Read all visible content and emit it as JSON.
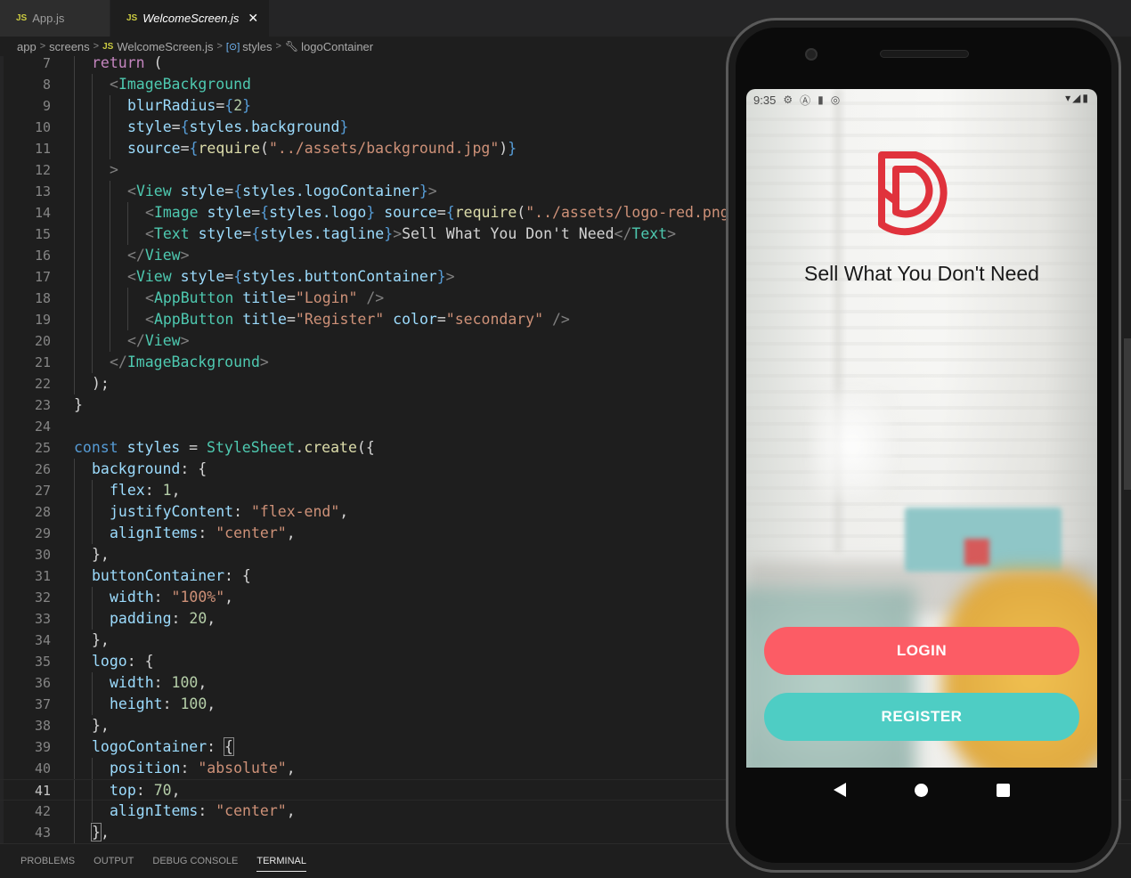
{
  "tabs": [
    {
      "label": "App.js",
      "icon": "JS"
    },
    {
      "label": "WelcomeScreen.js",
      "icon": "JS",
      "close": "✕"
    }
  ],
  "breadcrumb": [
    "app",
    "screens",
    "WelcomeScreen.js",
    "styles",
    "logoContainer"
  ],
  "breadcrumb_js": "JS",
  "code": {
    "lines": [
      "7",
      "8",
      "9",
      "10",
      "11",
      "12",
      "13",
      "14",
      "15",
      "16",
      "17",
      "18",
      "19",
      "20",
      "21",
      "22",
      "23",
      "24",
      "25",
      "26",
      "27",
      "28",
      "29",
      "30",
      "31",
      "32",
      "33",
      "34",
      "35",
      "36",
      "37",
      "38",
      "39",
      "40",
      "41",
      "42",
      "43"
    ],
    "l7": "return",
    "l7b": " (",
    "image_background": "ImageBackground",
    "blur_radius": "blurRadius",
    "blur_value": "2",
    "style_attr": "style",
    "styles_background": "styles.background",
    "source_attr": "source",
    "require": "require",
    "bg_path": "\"../assets/background.jpg\"",
    "view": "View",
    "styles_logo_container": "styles.logoContainer",
    "image": "Image",
    "styles_logo": "styles.logo",
    "logo_path": "\"../assets/logo-red.png",
    "text": "Text",
    "styles_tagline": "styles.tagline",
    "tagline_text": "Sell What You Don't Need",
    "styles_button_container": "styles.buttonContainer",
    "app_button": "AppButton",
    "title_attr": "title",
    "login_title": "\"Login\"",
    "register_title": "\"Register\"",
    "color_attr": "color",
    "secondary": "\"secondary\"",
    "const": "const",
    "styles_name": "styles",
    "stylesheet": "StyleSheet",
    "create": "create",
    "background": "background",
    "flex": "flex",
    "flex_val": "1",
    "justify_content": "justifyContent",
    "flex_end": "\"flex-end\"",
    "align_items": "alignItems",
    "center": "\"center\"",
    "button_container": "buttonContainer",
    "width": "width",
    "width_100": "\"100%\"",
    "padding": "padding",
    "padding_val": "20",
    "logo": "logo",
    "hundred": "100",
    "height": "height",
    "logo_container": "logoContainer",
    "position": "position",
    "absolute": "\"absolute\"",
    "top": "top",
    "top_val": "70"
  },
  "panel": {
    "tabs": [
      "PROBLEMS",
      "OUTPUT",
      "DEBUG CONSOLE",
      "TERMINAL"
    ],
    "active": "TERMINAL"
  },
  "phone": {
    "time": "9:35",
    "tagline": "Sell What You Don't Need",
    "login_label": "LOGIN",
    "register_label": "REGISTER",
    "colors": {
      "primary": "#fc5c65",
      "secondary": "#4ecdc4",
      "logo": "#e0323c"
    }
  }
}
